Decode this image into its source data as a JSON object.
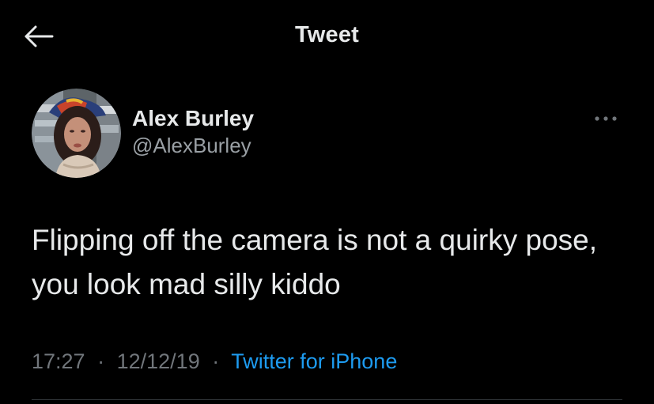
{
  "header": {
    "title": "Tweet",
    "back_icon": "arrow-left-icon"
  },
  "tweet": {
    "author": {
      "display_name": "Alex Burley",
      "handle": "@AlexBurley",
      "avatar_icon": "profile-photo"
    },
    "more_icon": "more-horizontal-icon",
    "text": "Flipping off the camera is not a quirky pose, you look mad silly kiddo",
    "time": "17:27",
    "date": "12/12/19",
    "separator": "·",
    "source": "Twitter for iPhone"
  },
  "colors": {
    "background": "#000000",
    "primary_text": "#e7e9ea",
    "secondary_text": "#71767b",
    "link": "#1d9bf0",
    "divider": "#2f3336"
  }
}
